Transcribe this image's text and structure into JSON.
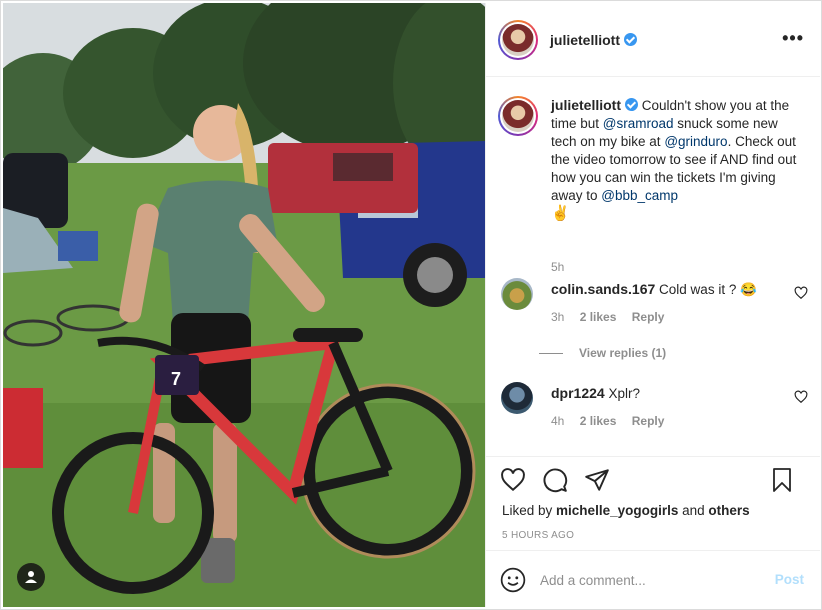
{
  "post": {
    "author": "julietelliott",
    "more_icon": "more-horizontal-icon",
    "more_label": "•••"
  },
  "caption": {
    "username": "julietelliott",
    "text_1": "Couldn't show you at the time but ",
    "mention_1": "@sramroad",
    "text_2": " snuck some new tech on my bike at ",
    "mention_2": "@grinduro",
    "text_3": ". Check out the video tomorrow to see if AND find out how you can win the tickets I'm giving away to ",
    "mention_3": "@bbb_camp",
    "emoji": "✌",
    "time": "5h"
  },
  "comments": [
    {
      "username": "colin.sands.167",
      "text": "Cold was it ?",
      "emoji": "😂",
      "time": "3h",
      "likes": "2 likes",
      "reply": "Reply",
      "view_replies": "View replies (1)"
    },
    {
      "username": "dpr1224",
      "text": "Xplr?",
      "time": "4h",
      "likes": "2 likes",
      "reply": "Reply"
    }
  ],
  "photo": {
    "bib_number": "7"
  },
  "actions": {
    "liked_prefix": "Liked by ",
    "liked_user": "michelle_yogogirls",
    "liked_and": " and ",
    "liked_others": "others",
    "time_ago": "5 HOURS AGO"
  },
  "composer": {
    "placeholder": "Add a comment...",
    "post_label": "Post"
  },
  "colors": {
    "link": "#00376b",
    "verified": "#3897f0",
    "muted": "#8e8e8e",
    "post_button": "#b2dffc"
  }
}
